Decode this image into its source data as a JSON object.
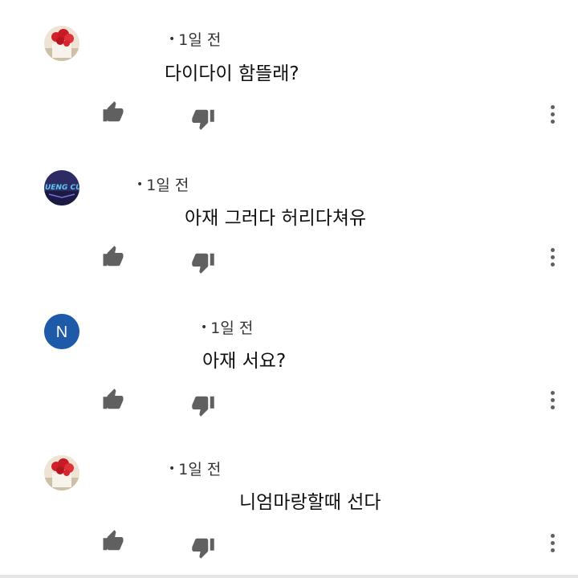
{
  "comments": [
    {
      "time": "1일 전",
      "text": "다이다이 함뜰래?",
      "avatar": "rose-bouquet-avatar"
    },
    {
      "time": "1일 전",
      "text": "아재 그러다 허리다쳐유",
      "avatar": "jueng-cu-logo-avatar",
      "avatar_text": "JUENG CU"
    },
    {
      "time": "1일 전",
      "text": "아재 서요?",
      "avatar": "letter-avatar",
      "avatar_letter": "N"
    },
    {
      "time": "1일 전",
      "text": "니엄마랑할때 선다",
      "avatar": "rose-bouquet-avatar"
    }
  ],
  "icons": {
    "like": "thumb-up-icon",
    "dislike": "thumb-down-icon",
    "more": "more-vertical-icon"
  },
  "colors": {
    "icon": "#606060",
    "letter_avatar_bg": "#1e5aa8",
    "logo_avatar_bg": "#2c2b63",
    "rose": "#d01f2b"
  }
}
